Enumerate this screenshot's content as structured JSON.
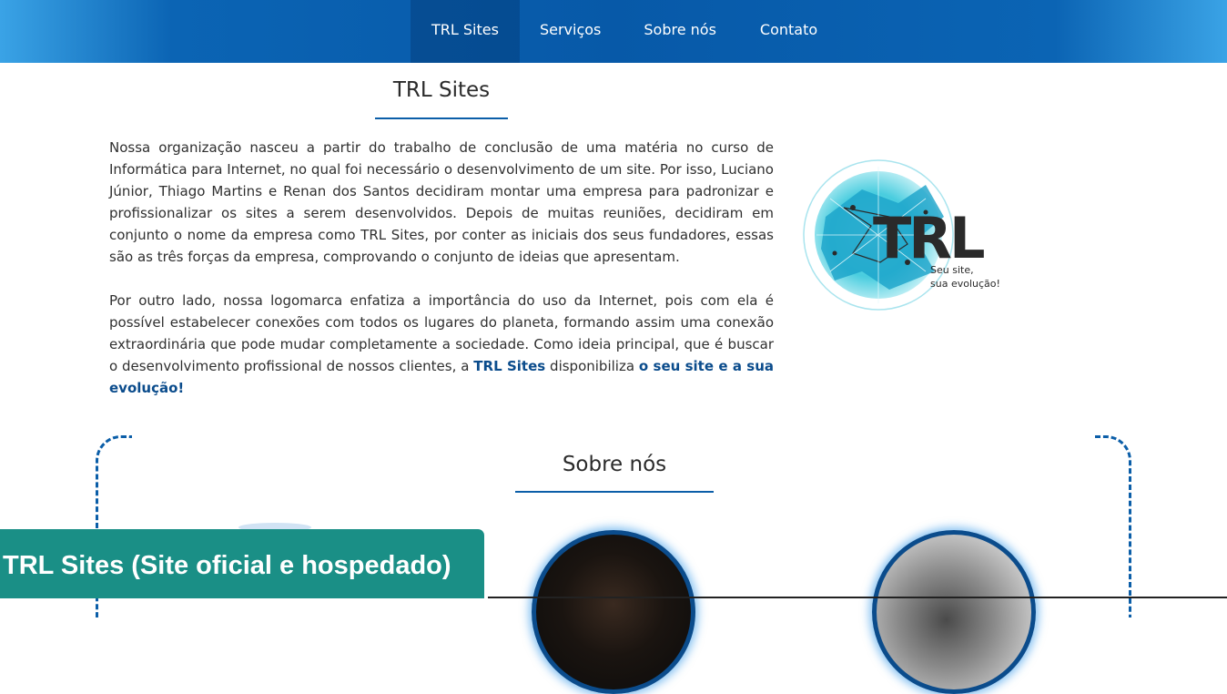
{
  "nav": {
    "items": [
      {
        "label": "TRL Sites",
        "active": true
      },
      {
        "label": "Serviços",
        "active": false
      },
      {
        "label": "Sobre nós",
        "active": false
      },
      {
        "label": "Contato",
        "active": false
      }
    ]
  },
  "about": {
    "title": "TRL Sites",
    "paragraph1": "Nossa organização nasceu a partir do trabalho de conclusão de uma matéria no curso de Informática para Internet, no qual foi necessário o desenvolvimento de um site. Por isso, Luciano Júnior, Thiago Martins e Renan dos Santos decidiram montar uma empresa para padronizar e profissionalizar os sites a serem desenvolvidos. Depois de muitas reuniões, decidiram em conjunto o nome da empresa como TRL Sites, por conter as iniciais dos seus fundadores, essas são as três forças da empresa, comprovando o conjunto de ideias que apresentam.",
    "paragraph2_start": "Por outro lado, nossa logomarca enfatiza a importância do uso da Internet, pois com ela é possível estabelecer conexões com todos os lugares do planeta, formando assim uma conexão extraordinária que pode mudar completamente a sociedade. Como ideia principal, que é buscar o desenvolvimento profissional de nossos clientes, a",
    "paragraph2_brand": "TRL Sites",
    "paragraph2_middle": "disponibiliza",
    "paragraph2_slogan": "o seu site e a sua evolução!"
  },
  "logo": {
    "mark": "TRL",
    "tagline1": "Seu site,",
    "tagline2": "sua evolução!",
    "colors": {
      "globe": "#29c4d9",
      "text": "#2a2a2a"
    }
  },
  "team": {
    "title": "Sobre nós"
  },
  "caption": {
    "text": "TRL Sites (Site oficial e hospedado)"
  },
  "colors": {
    "nav_blue": "#0759a8",
    "accent": "#0b5ea8",
    "caption_bg": "#1a8f86"
  }
}
